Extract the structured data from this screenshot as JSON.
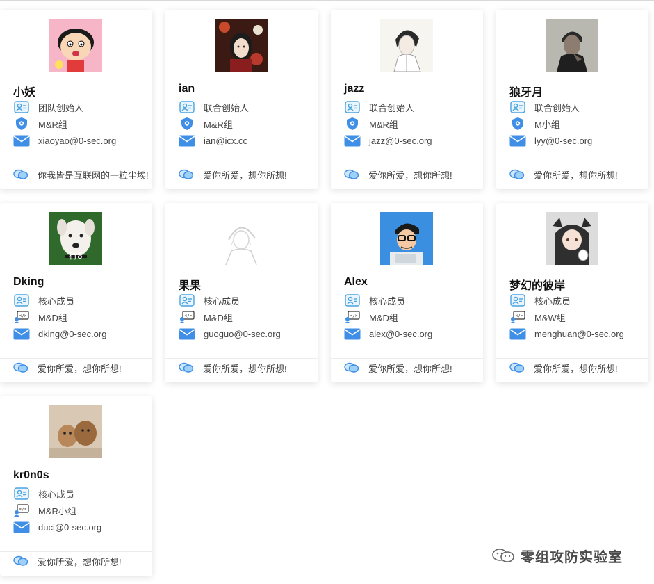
{
  "members": [
    {
      "name": "小妖",
      "role": "团队创始人",
      "group": "M&R组",
      "group_icon": "shield-icon",
      "email": "xiaoyao@0-sec.org",
      "motto": "你我皆是互联网的一粒尘埃!",
      "avatar": "cartoon-boy-pink"
    },
    {
      "name": "ian",
      "role": "联合创始人",
      "group": "M&R组",
      "group_icon": "shield-icon",
      "email": "ian@icx.cc",
      "motto": "爱你所爱，想你所想!",
      "avatar": "anime-girl-red"
    },
    {
      "name": "jazz",
      "role": "联合创始人",
      "group": "M&R组",
      "group_icon": "shield-icon",
      "email": "jazz@0-sec.org",
      "motto": "爱你所爱，想你所想!",
      "avatar": "sketch-boy"
    },
    {
      "name": "狼牙月",
      "role": "联合创始人",
      "group": "M小组",
      "group_icon": "shield-icon",
      "email": "lyy@0-sec.org",
      "motto": "爱你所爱，想你所想!",
      "avatar": "man-portrait-dark"
    },
    {
      "name": "Dking",
      "role": "核心成员",
      "group": "M&D组",
      "group_icon": "code-person-icon",
      "email": "dking@0-sec.org",
      "motto": "爱你所爱，想你所想!",
      "avatar": "white-dog",
      "avatar_caption": "行8"
    },
    {
      "name": "果果",
      "role": "核心成员",
      "group": "M&D组",
      "group_icon": "code-person-icon",
      "email": "guoguo@0-sec.org",
      "motto": "爱你所爱，想你所想!",
      "avatar": "sketch-girl"
    },
    {
      "name": "Alex",
      "role": "核心成员",
      "group": "M&D组",
      "group_icon": "code-person-icon",
      "email": "alex@0-sec.org",
      "motto": "爱你所爱，想你所想!",
      "avatar": "cartoon-glasses-man"
    },
    {
      "name": "梦幻的彼岸",
      "role": "核心成员",
      "group": "M&W组",
      "group_icon": "code-person-icon",
      "email": "menghuan@0-sec.org",
      "motto": "爱你所爱，想你所想!",
      "avatar": "anime-hood-girl"
    },
    {
      "name": "kr0n0s",
      "role": "核心成员",
      "group": "M&R小组",
      "group_icon": "code-person-icon",
      "email": "duci@0-sec.org",
      "motto": "爱你所爱，想你所想!",
      "avatar": "two-dogs"
    }
  ],
  "watermark": {
    "text": "零组攻防实验室",
    "icon": "wechat-icon"
  },
  "colors": {
    "icon_blue": "#4a90e2",
    "icon_light": "#7cc4f0",
    "accent": "#2f8ee6"
  }
}
